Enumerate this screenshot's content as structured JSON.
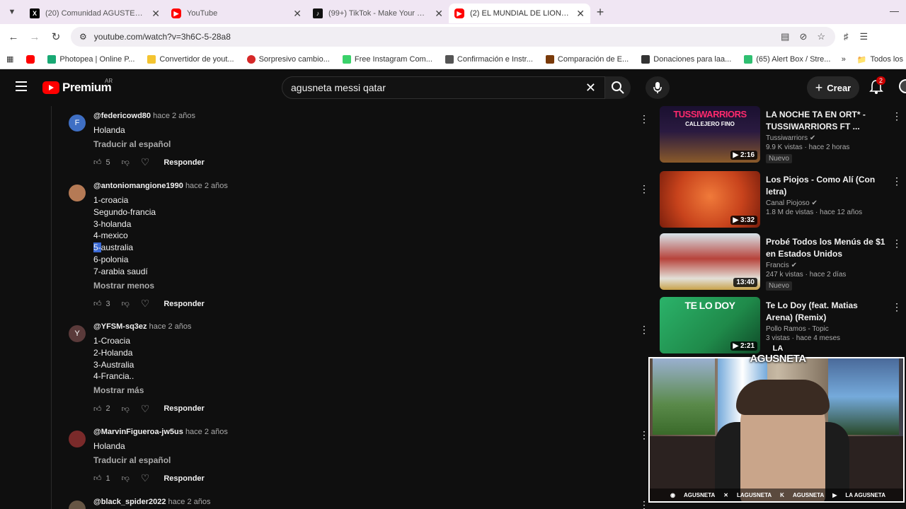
{
  "browser": {
    "tabs": [
      {
        "title": "(20) Comunidad AGUSTETISMO",
        "icon": "x-icon"
      },
      {
        "title": "YouTube",
        "icon": "youtube-icon"
      },
      {
        "title": "(99+) TikTok - Make Your Day",
        "icon": "tiktok-icon"
      },
      {
        "title": "(2) EL MUNDIAL DE LIONEL ME",
        "icon": "youtube-icon"
      }
    ],
    "active_tab_index": 3,
    "url": "youtube.com/watch?v=3h6C-5-28a8",
    "bookmarks": [
      {
        "label": "",
        "color": "#ff0000"
      },
      {
        "label": "Photopea | Online P...",
        "color": "#19a974"
      },
      {
        "label": "Convertidor de yout...",
        "color": "#f4c430"
      },
      {
        "label": "Sorpresivo cambio...",
        "color": "#d62828"
      },
      {
        "label": "Free Instagram Com...",
        "color": "#3ad16a"
      },
      {
        "label": "Confirmación e Instr...",
        "color": "#555555"
      },
      {
        "label": "Comparación de E...",
        "color": "#7a3a0a"
      },
      {
        "label": "Donaciones para laa...",
        "color": "#333333"
      },
      {
        "label": "(65) Alert Box / Stre...",
        "color": "#2fbf71"
      }
    ],
    "bookmarks_folder": "Todos los"
  },
  "youtube": {
    "logo_text": "Premium",
    "region": "AR",
    "search_query": "agusneta messi qatar",
    "create_label": "Crear",
    "notification_count": "2"
  },
  "comments": [
    {
      "handle": "@federicowd80",
      "time": "hace 2 años",
      "avatar_letter": "F",
      "avatar_color": "#3f6fc4",
      "lines": [
        "Holanda"
      ],
      "more_label": "Traducir al español",
      "likes": "5",
      "reply_label": "Responder"
    },
    {
      "handle": "@antoniomangione1990",
      "time": "hace 2 años",
      "avatar_letter": "",
      "avatar_color": "#b57a55",
      "lines": [
        "1-croacia",
        "Segundo-francia",
        "3-holanda",
        "4-mexico",
        "5-australia",
        "6-polonia",
        "7-arabia saudí"
      ],
      "more_label": "Mostrar menos",
      "likes": "3",
      "reply_label": "Responder"
    },
    {
      "handle": "@YFSM-sq3ez",
      "time": "hace 2 años",
      "avatar_letter": "Y",
      "avatar_color": "#5a3a3a",
      "lines": [
        "1-Croacia",
        "2-Holanda",
        "3-Australia",
        "4-Francia.."
      ],
      "more_label": "Mostrar más",
      "likes": "2",
      "reply_label": "Responder"
    },
    {
      "handle": "@MarvinFigueroa-jw5us",
      "time": "hace 2 años",
      "avatar_letter": "",
      "avatar_color": "#7a2a2a",
      "lines": [
        "Holanda"
      ],
      "more_label": "Traducir al español",
      "likes": "1",
      "reply_label": "Responder"
    },
    {
      "handle": "@black_spider2022",
      "time": "hace 2 años",
      "avatar_letter": "",
      "avatar_color": "#665544",
      "lines": [],
      "more_label": "",
      "likes": "",
      "reply_label": ""
    }
  ],
  "related": [
    {
      "title": "LA NOCHE TA EN ORT* - TUSSIWARRIORS FT ...",
      "channel": "Tussiwarriors",
      "meta": "9.9 K vistas · hace 2 horas",
      "badge": "Nuevo",
      "duration": "2:16",
      "thumb_text": "TUSSIWARRIORS",
      "thumb_subtext": "CALLEJERO FINO",
      "thumb_color": "#1a1030"
    },
    {
      "title": "Los Piojos - Como Alí (Con letra)",
      "channel": "Canal Piojoso",
      "meta": "1.8 M de vistas · hace 12 años",
      "badge": "",
      "duration": "3:32",
      "thumb_text": "",
      "thumb_subtext": "",
      "thumb_color": "#c8431c"
    },
    {
      "title": "Probé Todos los Menús de $1 en Estados Unidos",
      "channel": "Francis",
      "meta": "247 k vistas · hace 2 días",
      "badge": "Nuevo",
      "duration": "13:40",
      "thumb_text": "",
      "thumb_subtext": "",
      "thumb_color": "#b7433b"
    },
    {
      "title": "Te Lo Doy (feat. Matias Arena) (Remix)",
      "channel": "Pollo Ramos - Topic",
      "meta": "3 vistas · hace 4 meses",
      "badge": "",
      "duration": "2:21",
      "thumb_text": "TE LO DOY",
      "thumb_subtext": "",
      "thumb_color": "#1f8a4a"
    }
  ],
  "webcam": {
    "overlay_logo_top": "LA",
    "overlay_logo_main": "AGUSNETA",
    "socials": [
      "AGUSNETA",
      "LAGUSNETA",
      "AGUSNETA",
      "LA AGUSNETA"
    ]
  }
}
